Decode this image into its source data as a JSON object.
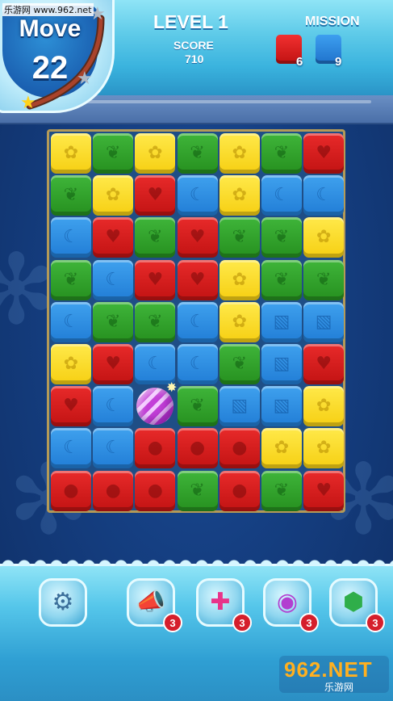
{
  "watermark_top": "乐游网 www.962.net",
  "hud": {
    "move_label": "Move",
    "moves_left": "22",
    "level_label": "LEVEL 1",
    "score_label": "SCORE",
    "score_value": "710",
    "mission_label": "MISSION",
    "missions": [
      {
        "color": "#e01c1c",
        "count": "6"
      },
      {
        "color": "#2e7fd8",
        "count": "9"
      }
    ]
  },
  "board": {
    "rows": 9,
    "cols": 7,
    "grid": [
      [
        "yellow-flower",
        "green-leaf",
        "yellow-flower",
        "green-leaf",
        "yellow-flower",
        "green-leaf",
        "red-heart"
      ],
      [
        "green-leaf",
        "yellow-flower",
        "red-heart",
        "blue-moon",
        "yellow-flower",
        "blue-moon",
        "blue-moon"
      ],
      [
        "blue-moon",
        "red-heart",
        "green-leaf",
        "red-heart",
        "green-leaf",
        "green-leaf",
        "yellow-flower"
      ],
      [
        "green-leaf",
        "blue-moon",
        "red-heart",
        "red-heart",
        "yellow-flower",
        "green-leaf",
        "green-leaf"
      ],
      [
        "blue-moon",
        "green-leaf",
        "green-leaf",
        "blue-moon",
        "yellow-flower",
        "blue-stripe",
        "blue-stripe"
      ],
      [
        "yellow-flower",
        "red-heart",
        "blue-moon",
        "blue-moon",
        "green-leaf",
        "blue-stripe",
        "red-heart"
      ],
      [
        "red-heart",
        "blue-moon",
        "color-ball",
        "green-leaf",
        "blue-stripe",
        "blue-stripe",
        "yellow-flower"
      ],
      [
        "blue-moon",
        "blue-moon",
        "red-bomb",
        "red-bomb",
        "red-bomb",
        "yellow-flower",
        "yellow-flower"
      ],
      [
        "red-bomb",
        "red-bomb",
        "red-bomb",
        "green-leaf",
        "red-bomb",
        "green-leaf",
        "red-heart"
      ]
    ]
  },
  "toolbar": {
    "tools": [
      {
        "icon": "gear-icon",
        "glyph": "⚙",
        "badge": ""
      },
      {
        "icon": "hammer-cannon-icon",
        "glyph": "📣",
        "badge": "3"
      },
      {
        "icon": "cross-arrows-icon",
        "glyph": "✚",
        "badge": "3"
      },
      {
        "icon": "color-ball-icon",
        "glyph": "◉",
        "badge": "3"
      },
      {
        "icon": "rainbow-ball-icon",
        "glyph": "⬢",
        "badge": "3"
      }
    ]
  },
  "watermark_bottom": {
    "main": "962.NET",
    "sub": "乐游网"
  }
}
